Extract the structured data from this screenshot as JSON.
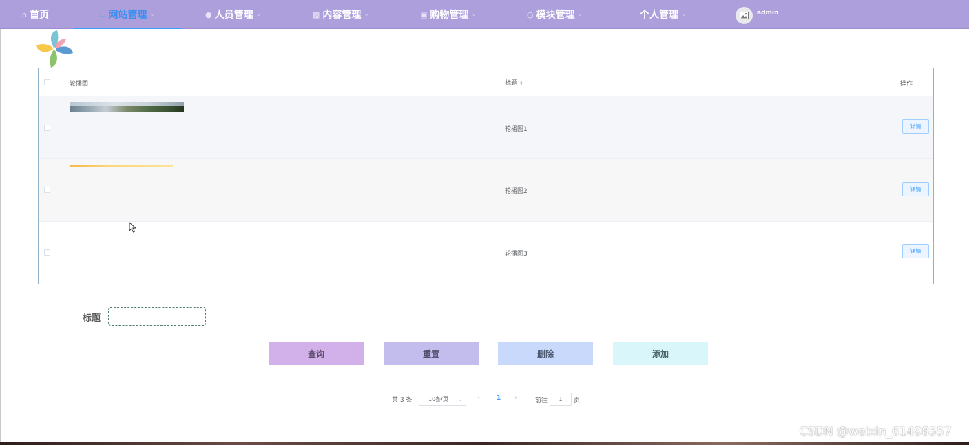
{
  "nav": {
    "items": [
      {
        "label": "首页",
        "icon": "home-icon",
        "active": false,
        "dropdown": false
      },
      {
        "label": "网站管理",
        "icon": "monitor-icon",
        "active": true,
        "dropdown": true
      },
      {
        "label": "人员管理",
        "icon": "user-icon",
        "active": false,
        "dropdown": true
      },
      {
        "label": "内容管理",
        "icon": "document-icon",
        "active": false,
        "dropdown": true
      },
      {
        "label": "购物管理",
        "icon": "shopping-bag-icon",
        "active": false,
        "dropdown": true
      },
      {
        "label": "模块管理",
        "icon": "chat-icon",
        "active": false,
        "dropdown": true
      },
      {
        "label": "个人管理",
        "icon": "",
        "active": false,
        "dropdown": true
      }
    ],
    "user": {
      "name": "admin",
      "avatar_icon": "image-icon"
    },
    "colors": {
      "bar": "#ac9fdc",
      "active": "#409eff"
    }
  },
  "logo": {
    "icon": "pinwheel-logo-icon"
  },
  "table": {
    "headers": {
      "image": "轮播图",
      "title": "标题",
      "actions": "操作"
    },
    "rows": [
      {
        "title": "轮播图1",
        "image": "landscape-thumbnail",
        "action": "详情"
      },
      {
        "title": "轮播图2",
        "image": "yellow-banner-thumbnail",
        "action": "详情"
      },
      {
        "title": "轮播图3",
        "image": "",
        "action": "详情"
      }
    ]
  },
  "search": {
    "label": "标题",
    "value": "",
    "placeholder": ""
  },
  "buttons": {
    "query": "查询",
    "reset": "重置",
    "delete": "删除",
    "add": "添加"
  },
  "pagination": {
    "total_text": "共 3 条",
    "page_size": "10条/页",
    "current_page": "1",
    "goto_label": "前往",
    "goto_value": "1",
    "page_suffix": "页"
  },
  "watermark": "CSDN @weixin_61498557"
}
